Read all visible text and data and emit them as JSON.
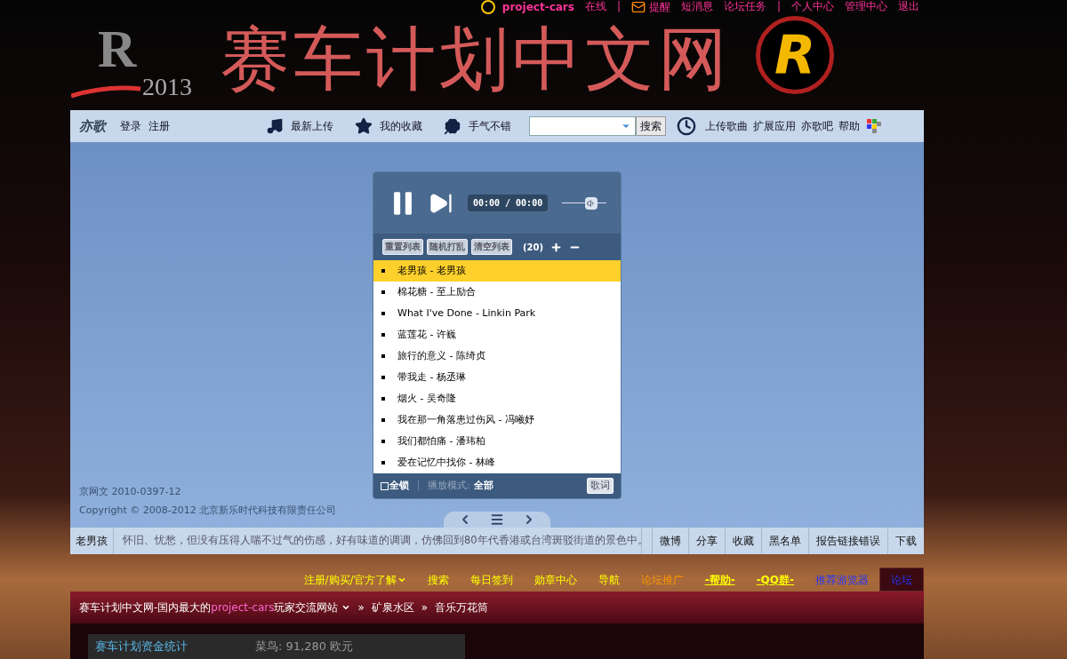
{
  "top_links": [
    {
      "kind": "user",
      "text": "project-cars"
    },
    {
      "kind": "link",
      "text": "在线"
    },
    {
      "kind": "separator",
      "text": "|"
    },
    {
      "kind": "mail",
      "text": "提醒"
    },
    {
      "kind": "link",
      "text": "短消息"
    },
    {
      "kind": "link",
      "text": "论坛任务"
    },
    {
      "kind": "separator",
      "text": "|"
    },
    {
      "kind": "link",
      "text": "个人中心"
    },
    {
      "kind": "link",
      "text": "管理中心"
    },
    {
      "kind": "link",
      "text": "退出"
    }
  ],
  "header": {
    "logo_mark": "R",
    "logo_year": "2013",
    "title": "赛车计划中文网",
    "badge_letter": "R"
  },
  "navbar": {
    "brand": "亦歌",
    "left_links": [
      "登录",
      "注册"
    ],
    "features": [
      {
        "kind": "music",
        "label": "最新上传"
      },
      {
        "kind": "star",
        "label": "我的收藏"
      },
      {
        "kind": "clover",
        "label": "手气不错"
      }
    ],
    "search_button": "搜索",
    "right_links": [
      "上传歌曲",
      "扩展应用",
      "亦歌吧",
      "帮助"
    ]
  },
  "player": {
    "playing": true,
    "time": "00:00 / 00:00",
    "volume": {
      "level": 0.65
    },
    "tools": [
      "重置列表",
      "随机打乱",
      "清空列表"
    ],
    "count": "(20)",
    "playlist": [
      {
        "title": "老男孩 - 老男孩",
        "selected": true
      },
      {
        "title": "棉花糖 - 至上励合",
        "selected": false
      },
      {
        "title": "What I've Done - Linkin Park",
        "selected": false
      },
      {
        "title": "蓝莲花 - 许巍",
        "selected": false
      },
      {
        "title": "旅行的意义 - 陈绮贞",
        "selected": false
      },
      {
        "title": "带我走 - 杨丞琳",
        "selected": false
      },
      {
        "title": "烟火 - 吴奇隆",
        "selected": false
      },
      {
        "title": "我在那一角落患过伤风 - 冯曦妤",
        "selected": false
      },
      {
        "title": "我们都怕痛 - 潘玮柏",
        "selected": false
      },
      {
        "title": "爱在记忆中找你 - 林峰",
        "selected": false
      }
    ],
    "lock": {
      "label": "全锁",
      "checked": false
    },
    "mode_label": "播放模式:",
    "mode": "全部",
    "lyrics_button": "歌词"
  },
  "footer_notes": [
    "京网文 2010-0397-12",
    "Copyright © 2008-2012 北京新乐时代科技有限责任公司"
  ],
  "now_playing": {
    "title": "老男孩",
    "description": "怀旧、忧愁，但没有压得人喘不过气的伤感，好有味道的调调，仿佛回到80年代香港或台湾斑驳街道的景色中。",
    "actions": [
      "微博",
      "分享",
      "收藏",
      "黑名单",
      "报告链接错误",
      "下载"
    ]
  },
  "forum_nav": [
    {
      "label": "注册/购买/官方了解",
      "kind": "standard",
      "dropdown": true,
      "selected": false
    },
    {
      "label": "搜索",
      "kind": "standard",
      "dropdown": false,
      "selected": false
    },
    {
      "label": "每日签到",
      "kind": "standard",
      "dropdown": false,
      "selected": false
    },
    {
      "label": "勋章中心",
      "kind": "standard",
      "dropdown": false,
      "selected": false
    },
    {
      "label": "导航",
      "kind": "standard",
      "dropdown": false,
      "selected": false
    },
    {
      "label": "论坛推广",
      "kind": "promo",
      "dropdown": false,
      "selected": false
    },
    {
      "label": "-帮助-",
      "kind": "emphasis",
      "dropdown": false,
      "selected": false
    },
    {
      "label": "-QQ群-",
      "kind": "emphasis",
      "dropdown": false,
      "selected": false
    },
    {
      "label": "推荐游览器",
      "kind": "recommend",
      "dropdown": false,
      "selected": false
    },
    {
      "label": "论坛",
      "kind": "recommend",
      "dropdown": false,
      "selected": true
    }
  ],
  "breadcrumb": {
    "site": [
      {
        "text": "赛车计划中文网-国内最大的",
        "highlight": false
      },
      {
        "text": "project-cars",
        "highlight": true
      },
      {
        "text": "玩家交流网站",
        "highlight": false
      }
    ],
    "separator": "»",
    "items": [
      "矿泉水区",
      "音乐万花筒"
    ]
  },
  "stats": {
    "title": "赛车计划资金统计",
    "value": "菜鸟: 91,280 欧元"
  }
}
